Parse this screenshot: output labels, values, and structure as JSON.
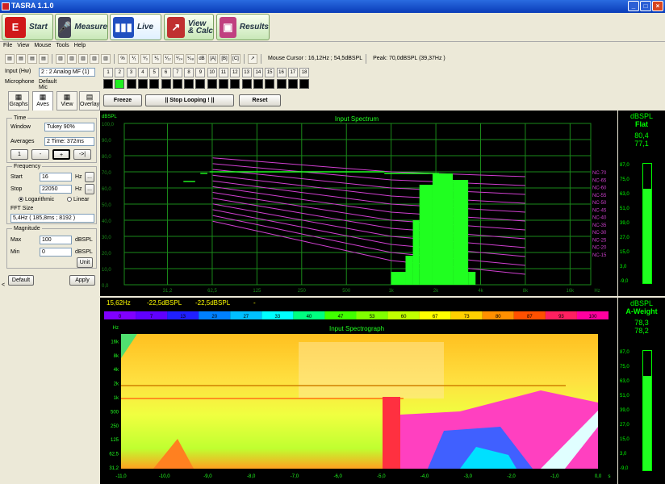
{
  "window": {
    "title": "TASRA 1.1.0",
    "controls": [
      "_",
      "□",
      "×"
    ]
  },
  "main_tabs": [
    {
      "label": "Start",
      "icon": "start-E-icon",
      "icon_glyph": "E",
      "icon_color": "#d01818"
    },
    {
      "label": "Measure",
      "icon": "microphone-icon",
      "icon_glyph": "🎤",
      "icon_color": "#445"
    },
    {
      "label": "Live",
      "icon": "live-bars-icon",
      "icon_glyph": "▮▮▮",
      "icon_color": "#2050c0"
    },
    {
      "label": "View\n& Calc",
      "icon": "view-calc-graph-icon",
      "icon_glyph": "↗",
      "icon_color": "#c03030"
    },
    {
      "label": "Results",
      "icon": "results-icon",
      "icon_glyph": "▣",
      "icon_color": "#c04080"
    }
  ],
  "menu": [
    "File",
    "View",
    "Mouse",
    "Tools",
    "Help"
  ],
  "toolbar": {
    "icons": [
      "open-folder-icon",
      "save-icon",
      "save-all-icon",
      "stack1-icon",
      "stack2-icon",
      "stack3-icon",
      "spectrum-icon",
      "octave-icon",
      "bars-icon",
      "x-icon",
      "frac-icon",
      "frac-icon",
      "frac-icon",
      "frac-icon",
      "frac-icon",
      "frac-icon"
    ],
    "buttons": [
      "%",
      "⅟₁",
      "⅟₃",
      "⅟₆",
      "⅟₁₂",
      "⅟₂₄",
      "⅟₄₈",
      "dB",
      "[A]",
      "[B]",
      "[C]"
    ],
    "mouse_cursor": "Mouse Cursor :  16,12Hz ; 54,5dBSPL",
    "peak": "Peak: 70,0dBSPL (39,37Hz )"
  },
  "input": {
    "label": "Input (Hw)",
    "value": "2 : 2 Analog MF (1)",
    "mic_label": "Microphone",
    "mic_value": "Default Mic"
  },
  "channels": [
    "1",
    "2",
    "3",
    "4",
    "5",
    "6",
    "7",
    "8",
    "9",
    "10",
    "11",
    "12",
    "13",
    "14",
    "15",
    "16",
    "17",
    "18"
  ],
  "active_channel": 2,
  "panel_tabs": [
    "Graphs",
    "Aves",
    "View",
    "Overlay"
  ],
  "time": {
    "group": "Time",
    "window_label": "Window",
    "window_value": "Tukey 90%",
    "averages_label": "Averages",
    "averages_value": "2  Time: 372ms",
    "nav": [
      "1",
      "-",
      "+",
      "->|"
    ]
  },
  "frequency": {
    "group": "Frequency",
    "start_label": "Start",
    "start_value": "16",
    "stop_label": "Stop",
    "stop_value": "22050",
    "unit": "Hz",
    "browse": "...",
    "log_label": "Logarithmic",
    "lin_label": "Linear",
    "fft_label": "FFT Size",
    "fft_value": "5,4Hz ( 185,8ms ; 8192 )"
  },
  "magnitude": {
    "group": "Magnitude",
    "max_label": "Max",
    "max_value": "100",
    "min_label": "Min",
    "min_value": "0",
    "unit": "dBSPL",
    "unit_btn": "Unit"
  },
  "panel_buttons": {
    "default": "Default",
    "apply": "Apply"
  },
  "controls": {
    "freeze": "Freeze",
    "stop_looping": "||   Stop Looping !   ||",
    "reset": "Reset"
  },
  "spectrum": {
    "title": "Input Spectrum",
    "yunit": "dBSPL",
    "yticks": [
      "100,0",
      "90,0",
      "80,0",
      "70,0",
      "60,0",
      "50,0",
      "40,0",
      "30,0",
      "20,0",
      "10,0",
      "0,0"
    ],
    "xticks": [
      "31,2",
      "62,5",
      "125",
      "250",
      "500",
      "1k",
      "2k",
      "4k",
      "8k",
      "16k",
      "Hz"
    ],
    "nc_labels": [
      "NC-70",
      "NC-65",
      "NC-60",
      "NC-55",
      "NC-50",
      "NC-45",
      "NC-40",
      "NC-35",
      "NC-30",
      "NC-25",
      "NC-20",
      "NC-15"
    ],
    "colors": {
      "grid": "#1a8a1a",
      "nc": "#d040d0",
      "bars": "#20ff20"
    }
  },
  "readout": {
    "f": "15,62Hz",
    "v1": "-22,5dBSPL",
    "v2": "-22,5dBSPL",
    "dash": "-"
  },
  "colorscale": [
    "0",
    "7",
    "13",
    "20",
    "27",
    "33",
    "40",
    "47",
    "53",
    "60",
    "67",
    "73",
    "80",
    "87",
    "93",
    "100"
  ],
  "spectrograph": {
    "title": "Input Spectrograph",
    "yticks": [
      "Hz",
      "16k",
      "8k",
      "4k",
      "2k",
      "1k",
      "500",
      "250",
      "125",
      "62,5",
      "31,2"
    ],
    "xticks": [
      "-11,0",
      "-10,0",
      "-9,0",
      "-8,0",
      "-7,0",
      "-6,0",
      "-5,0",
      "-4,0",
      "-3,0",
      "-2,0",
      "-1,0",
      "0,0",
      "s"
    ]
  },
  "meter1": {
    "title": "dBSPL",
    "weight": "Flat",
    "v1": "80,4",
    "v2": "77,1",
    "scale": [
      "87,0",
      "75,0",
      "63,0",
      "51,0",
      "39,0",
      "27,0",
      "15,0",
      "3,0",
      "-9,0"
    ],
    "level": 0.79
  },
  "meter2": {
    "title": "dBSPL",
    "weight": "A-Weight",
    "v1": "78,3",
    "v2": "78,2",
    "scale": [
      "87,0",
      "75,0",
      "63,0",
      "51,0",
      "39,0",
      "27,0",
      "15,0",
      "3,0",
      "-9,0"
    ],
    "level": 0.79
  },
  "left_arrow": "<"
}
